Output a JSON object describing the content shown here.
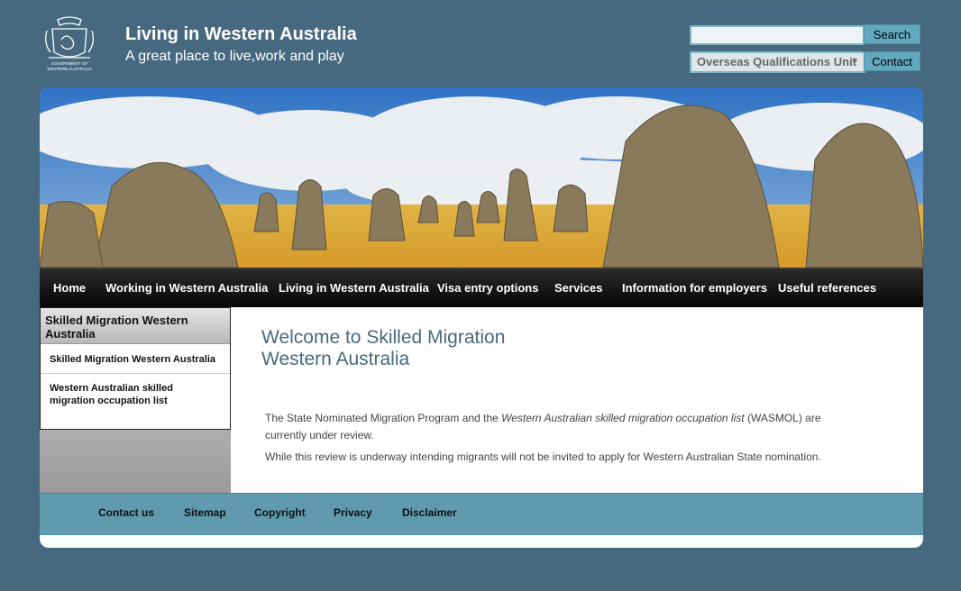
{
  "header": {
    "crest_caption": "GOVERNMENT OF WESTERN AUSTRALIA",
    "title": "Living in Western Australia",
    "tagline": "A great place to live,work and play"
  },
  "search": {
    "placeholder": "",
    "value": "",
    "button_label": "Search"
  },
  "unit_select": {
    "selected": "Overseas Qualifications Unit"
  },
  "contact_button": "Contact",
  "nav": {
    "items": [
      {
        "label": "Home"
      },
      {
        "label": "Working in Western Australia"
      },
      {
        "label": "Living in Western Australia"
      },
      {
        "label": "Visa entry options"
      },
      {
        "label": "Services"
      },
      {
        "label": "Information for employers"
      },
      {
        "label": "Useful references"
      }
    ]
  },
  "sidebar": {
    "heading": "Skilled Migration Western Australia",
    "links": [
      {
        "label": "Skilled Migration Western Australia"
      },
      {
        "label": "Western Australian skilled migration occupation list"
      }
    ]
  },
  "main": {
    "heading_line1": "Welcome to Skilled Migration",
    "heading_line2": "Western Australia",
    "p1_before": "The State Nominated Migration Program and the ",
    "p1_italic": "Western Australian skilled migration occupation list",
    "p1_after": " (WASMOL) are currently under review.",
    "p2": "While this review is underway intending migrants will not be invited to apply for Western Australian State nomination."
  },
  "footer": {
    "links": [
      {
        "label": "Contact us"
      },
      {
        "label": "Sitemap"
      },
      {
        "label": "Copyright"
      },
      {
        "label": "Privacy"
      },
      {
        "label": "Disclaimer"
      }
    ]
  }
}
